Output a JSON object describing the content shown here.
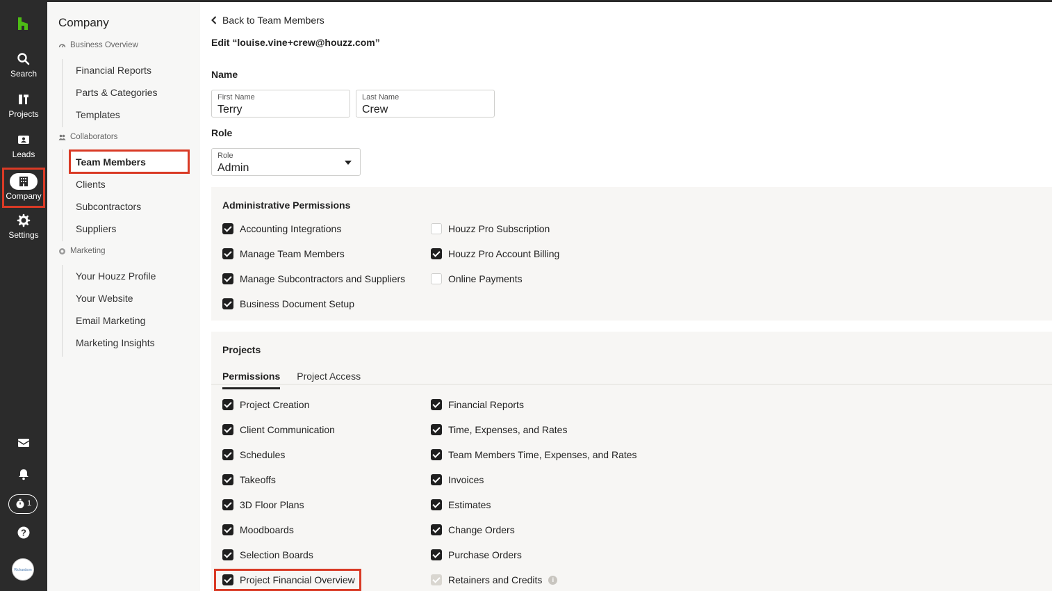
{
  "rail": {
    "items": [
      {
        "label": "Search",
        "icon": "search-icon"
      },
      {
        "label": "Projects",
        "icon": "projects-icon"
      },
      {
        "label": "Leads",
        "icon": "leads-icon"
      },
      {
        "label": "Company",
        "icon": "company-building-icon"
      },
      {
        "label": "Settings",
        "icon": "gear-icon"
      }
    ],
    "timer_count": "1",
    "avatar_text": "Richardson"
  },
  "sidebar": {
    "title": "Company",
    "groups": [
      {
        "label": "Business Overview",
        "items": [
          "Financial Reports",
          "Parts & Categories",
          "Templates"
        ]
      },
      {
        "label": "Collaborators",
        "items": [
          "Team Members",
          "Clients",
          "Subcontractors",
          "Suppliers"
        ]
      },
      {
        "label": "Marketing",
        "items": [
          "Your Houzz Profile",
          "Your Website",
          "Email Marketing",
          "Marketing Insights"
        ]
      }
    ]
  },
  "main": {
    "back_label": "Back to Team Members",
    "edit_title": "Edit “louise.vine+crew@houzz.com”",
    "name_section": "Name",
    "first_name": {
      "label": "First Name",
      "value": "Terry"
    },
    "last_name": {
      "label": "Last Name",
      "value": "Crew"
    },
    "role_section": "Role",
    "role": {
      "label": "Role",
      "value": "Admin"
    },
    "admin_permissions": {
      "title": "Administrative Permissions",
      "left": [
        {
          "label": "Accounting Integrations",
          "checked": true
        },
        {
          "label": "Manage Team Members",
          "checked": true
        },
        {
          "label": "Manage Subcontractors and Suppliers",
          "checked": true
        },
        {
          "label": "Business Document Setup",
          "checked": true
        }
      ],
      "right": [
        {
          "label": "Houzz Pro Subscription",
          "checked": false
        },
        {
          "label": "Houzz Pro Account Billing",
          "checked": true
        },
        {
          "label": "Online Payments",
          "checked": false
        }
      ]
    },
    "projects": {
      "title": "Projects",
      "tabs": [
        "Permissions",
        "Project Access"
      ],
      "left": [
        {
          "label": "Project Creation",
          "checked": true
        },
        {
          "label": "Client Communication",
          "checked": true
        },
        {
          "label": "Schedules",
          "checked": true
        },
        {
          "label": "Takeoffs",
          "checked": true
        },
        {
          "label": "3D Floor Plans",
          "checked": true
        },
        {
          "label": "Moodboards",
          "checked": true
        },
        {
          "label": "Selection Boards",
          "checked": true
        },
        {
          "label": "Project Financial Overview",
          "checked": true
        }
      ],
      "right": [
        {
          "label": "Financial Reports",
          "checked": true
        },
        {
          "label": "Time, Expenses, and Rates",
          "checked": true
        },
        {
          "label": "Team Members Time, Expenses, and Rates",
          "checked": true
        },
        {
          "label": "Invoices",
          "checked": true
        },
        {
          "label": "Estimates",
          "checked": true
        },
        {
          "label": "Change Orders",
          "checked": true
        },
        {
          "label": "Purchase Orders",
          "checked": true
        },
        {
          "label": "Retainers and Credits",
          "checked": true,
          "disabled": true
        }
      ]
    }
  },
  "colors": {
    "rail_bg": "#2b2b2b",
    "highlight": "#d93a25",
    "brand_green": "#4dbc15",
    "panel_bg": "#f7f6f4"
  }
}
